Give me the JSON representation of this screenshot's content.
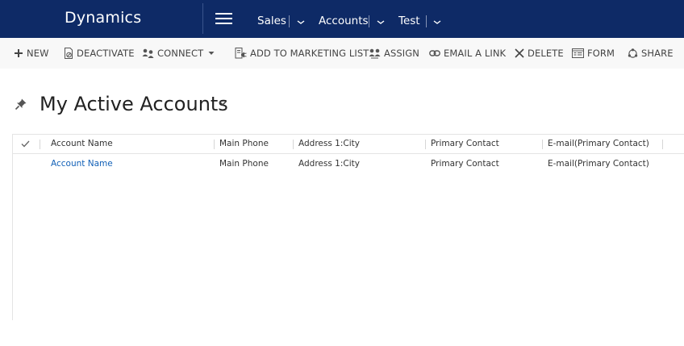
{
  "app": {
    "title": "Dynamics"
  },
  "nav": {
    "area": "Sales",
    "entity": "Accounts",
    "record": "Test"
  },
  "commands": [
    {
      "label": "NEW",
      "icon": "plus-icon"
    },
    {
      "label": "DEACTIVATE",
      "icon": "deactivate-icon"
    },
    {
      "label": "CONNECT",
      "icon": "connect-icon"
    },
    {
      "label": "ADD TO MARKETING LIST",
      "icon": "marketing-list-icon"
    },
    {
      "label": "ASSIGN",
      "icon": "assign-icon"
    },
    {
      "label": "EMAIL A LINK",
      "icon": "link-icon"
    },
    {
      "label": "DELETE",
      "icon": "delete-icon"
    },
    {
      "label": "FORM",
      "icon": "form-icon"
    },
    {
      "label": "SHARE",
      "icon": "share-icon"
    }
  ],
  "view": {
    "title": "My Active Accounts"
  },
  "grid": {
    "columns": [
      "Account Name",
      "Main Phone",
      "Address 1:City",
      "Primary Contact",
      "E-mail(Primary Contact)"
    ],
    "rows": [
      [
        "Account Name",
        "Main Phone",
        "Address 1:City",
        "Primary Contact",
        "E-mail(Primary Contact)"
      ]
    ]
  },
  "colors": {
    "topbar": "#0e2a66",
    "link": "#1160b7",
    "commandbar": "#f8f8f8"
  }
}
